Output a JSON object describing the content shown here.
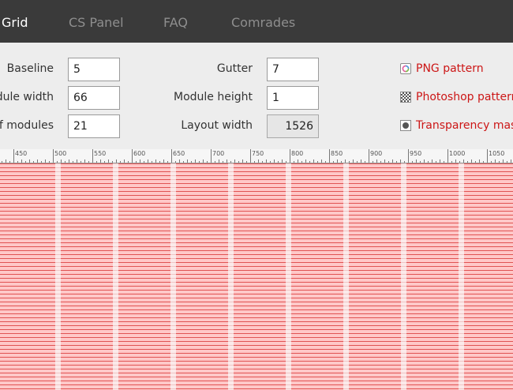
{
  "nav": {
    "items": [
      {
        "label": "Grid",
        "active": true
      },
      {
        "label": "CS Panel",
        "active": false
      },
      {
        "label": "FAQ",
        "active": false
      },
      {
        "label": "Comrades",
        "active": false
      }
    ]
  },
  "form": {
    "baseline": {
      "label": "Baseline",
      "value": "5"
    },
    "module_width": {
      "label": "dule width",
      "value": "66"
    },
    "num_modules": {
      "label": "of modules",
      "value": "21"
    },
    "gutter": {
      "label": "Gutter",
      "value": "7"
    },
    "module_height": {
      "label": "Module height",
      "value": "1"
    },
    "layout_width": {
      "label": "Layout width",
      "value": "1526"
    }
  },
  "downloads": {
    "png": {
      "label": "PNG pattern",
      "icon": "png-pattern-icon"
    },
    "psd": {
      "label": "Photoshop pattern",
      "icon": "photoshop-pattern-icon"
    },
    "mask": {
      "label": "Transparency mask",
      "icon": "transparency-mask-icon"
    }
  },
  "ruler": {
    "labels": [
      "450",
      "500",
      "550",
      "600",
      "650",
      "700",
      "750",
      "800",
      "850",
      "900",
      "950",
      "1000",
      "1050"
    ]
  },
  "colors": {
    "topbar": "#3a3a3a",
    "link": "#cc1616",
    "grid_fill": "#ffc8c8",
    "grid_line": "#dc4646"
  }
}
